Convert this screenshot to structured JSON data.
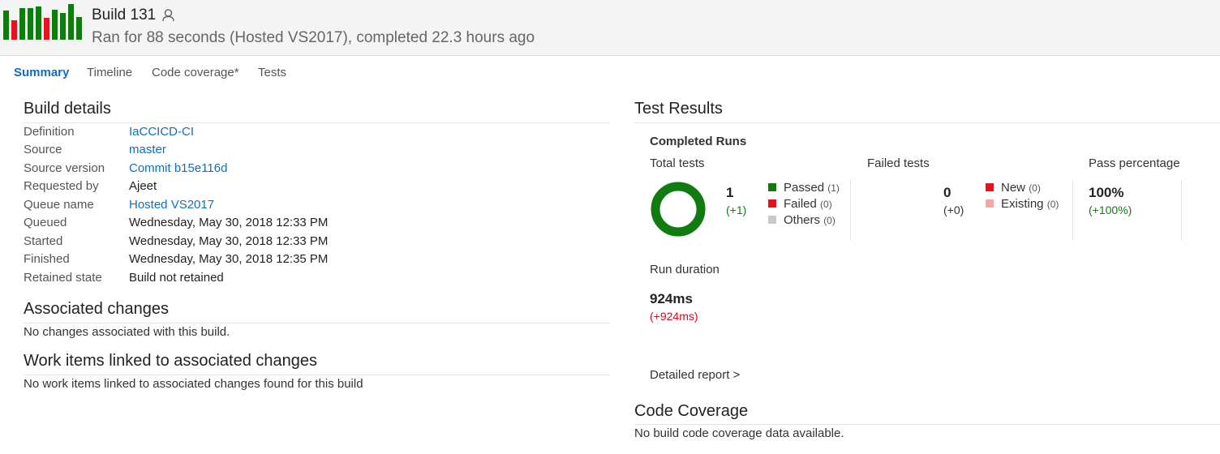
{
  "header": {
    "build_title": "Build 131",
    "subtitle": "Ran for 88 seconds (Hosted VS2017), completed 22.3 hours ago",
    "history_bars": [
      {
        "level": 0.82,
        "status": "succeeded",
        "color": "#107c10"
      },
      {
        "level": 0.55,
        "status": "failed",
        "color": "#e81123"
      },
      {
        "level": 0.88,
        "status": "succeeded",
        "color": "#107c10"
      },
      {
        "level": 0.88,
        "status": "succeeded",
        "color": "#107c10"
      },
      {
        "level": 0.93,
        "status": "succeeded",
        "color": "#107c10"
      },
      {
        "level": 0.62,
        "status": "failed",
        "color": "#e81123"
      },
      {
        "level": 0.84,
        "status": "succeeded",
        "color": "#107c10"
      },
      {
        "level": 0.75,
        "status": "succeeded",
        "color": "#107c10"
      },
      {
        "level": 1.0,
        "status": "succeeded",
        "color": "#107c10"
      },
      {
        "level": 0.64,
        "status": "succeeded",
        "color": "#107c10"
      }
    ]
  },
  "tabs": [
    {
      "label": "Summary",
      "active": true
    },
    {
      "label": "Timeline",
      "active": false
    },
    {
      "label": "Code coverage*",
      "active": false
    },
    {
      "label": "Tests",
      "active": false
    }
  ],
  "build_details": {
    "title": "Build details",
    "rows": [
      {
        "label": "Definition",
        "value": "IaCCICD-CI",
        "link": true
      },
      {
        "label": "Source",
        "value": "master",
        "link": true
      },
      {
        "label": "Source version",
        "value": "Commit b15e116d",
        "link": true
      },
      {
        "label": "Requested by",
        "value": "Ajeet",
        "link": false
      },
      {
        "label": "Queue name",
        "value": "Hosted VS2017",
        "link": true
      },
      {
        "label": "Queued",
        "value": "Wednesday, May 30, 2018 12:33 PM",
        "link": false
      },
      {
        "label": "Started",
        "value": "Wednesday, May 30, 2018 12:33 PM",
        "link": false
      },
      {
        "label": "Finished",
        "value": "Wednesday, May 30, 2018 12:35 PM",
        "link": false
      },
      {
        "label": "Retained state",
        "value": "Build not retained",
        "link": false
      }
    ]
  },
  "associated_changes": {
    "title": "Associated changes",
    "text": "No changes associated with this build."
  },
  "work_items": {
    "title": "Work items linked to associated changes",
    "text": "No work items linked to associated changes found for this build"
  },
  "test_results": {
    "title": "Test Results",
    "subtitle": "Completed Runs",
    "total": {
      "heading": "Total tests",
      "count": "1",
      "delta": "(+1)",
      "pass_fraction": 1.0,
      "legend": [
        {
          "label": "Passed",
          "count": "(1)",
          "color": "#107c10"
        },
        {
          "label": "Failed",
          "count": "(0)",
          "color": "#e81123"
        },
        {
          "label": "Others",
          "count": "(0)",
          "color": "#c8c8c8"
        }
      ]
    },
    "failed": {
      "heading": "Failed tests",
      "count": "0",
      "delta": "(+0)",
      "legend": [
        {
          "label": "New",
          "count": "(0)",
          "color": "#e81123"
        },
        {
          "label": "Existing",
          "count": "(0)",
          "color": "#f4a6a8"
        }
      ]
    },
    "pass_percentage": {
      "heading": "Pass percentage",
      "value": "100%",
      "delta": "(+100%)"
    },
    "run_duration": {
      "heading": "Run duration",
      "value": "924ms",
      "delta": "(+924ms)"
    },
    "detailed_report": "Detailed report >"
  },
  "code_coverage": {
    "title": "Code Coverage",
    "text": "No build code coverage data available."
  },
  "colors": {
    "accent": "#106ebe",
    "pass": "#107c10",
    "fail": "#e81123",
    "regress": "#c50f1f"
  }
}
